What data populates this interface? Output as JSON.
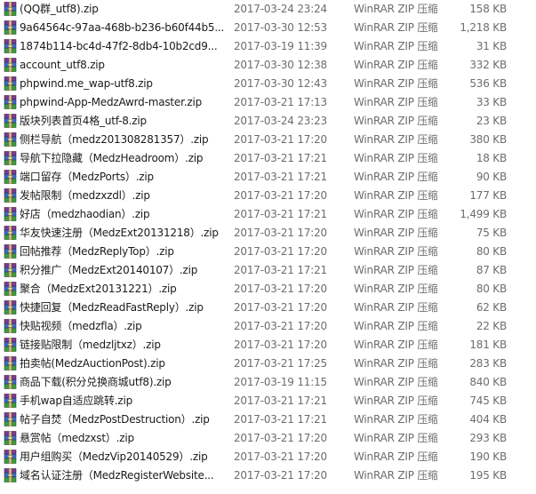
{
  "icons": {
    "row_icon": "winrar-archive-icon"
  },
  "colors": {
    "name_text": "#1a1a1a",
    "meta_text": "#6d6d6d",
    "background": "#ffffff"
  },
  "files": [
    {
      "name": "(QQ群_utf8).zip",
      "date": "2017-03-24 23:24",
      "type": "WinRAR ZIP 压缩...",
      "size": "158 KB"
    },
    {
      "name": "9a64564c-97aa-468b-b236-b60f44b5...",
      "date": "2017-03-30 12:53",
      "type": "WinRAR ZIP 压缩...",
      "size": "1,218 KB"
    },
    {
      "name": "1874b114-bc4d-47f2-8db4-10b2cd9...",
      "date": "2017-03-19 11:39",
      "type": "WinRAR ZIP 压缩...",
      "size": "31 KB"
    },
    {
      "name": "account_utf8.zip",
      "date": "2017-03-30 12:38",
      "type": "WinRAR ZIP 压缩...",
      "size": "332 KB"
    },
    {
      "name": "phpwind.me_wap-utf8.zip",
      "date": "2017-03-30 12:43",
      "type": "WinRAR ZIP 压缩...",
      "size": "536 KB"
    },
    {
      "name": "phpwind-App-MedzAwrd-master.zip",
      "date": "2017-03-21 17:13",
      "type": "WinRAR ZIP 压缩...",
      "size": "33 KB"
    },
    {
      "name": "版块列表首页4格_utf-8.zip",
      "date": "2017-03-24 23:23",
      "type": "WinRAR ZIP 压缩...",
      "size": "23 KB"
    },
    {
      "name": "侧栏导航（medz201308281357）.zip",
      "date": "2017-03-21 17:20",
      "type": "WinRAR ZIP 压缩...",
      "size": "380 KB"
    },
    {
      "name": "导航下拉隐藏（MedzHeadroom）.zip",
      "date": "2017-03-21 17:21",
      "type": "WinRAR ZIP 压缩...",
      "size": "18 KB"
    },
    {
      "name": "端口留存（MedzPorts）.zip",
      "date": "2017-03-21 17:21",
      "type": "WinRAR ZIP 压缩...",
      "size": "90 KB"
    },
    {
      "name": "发帖限制（medzxzdl）.zip",
      "date": "2017-03-21 17:20",
      "type": "WinRAR ZIP 压缩...",
      "size": "177 KB"
    },
    {
      "name": "好店（medzhaodian）.zip",
      "date": "2017-03-21 17:21",
      "type": "WinRAR ZIP 压缩...",
      "size": "1,499 KB"
    },
    {
      "name": "华友快速注册（MedzExt20131218）.zip",
      "date": "2017-03-21 17:20",
      "type": "WinRAR ZIP 压缩...",
      "size": "75 KB"
    },
    {
      "name": "回帖推荐（MedzReplyTop）.zip",
      "date": "2017-03-21 17:20",
      "type": "WinRAR ZIP 压缩...",
      "size": "80 KB"
    },
    {
      "name": "积分推广（MedzExt20140107）.zip",
      "date": "2017-03-21 17:21",
      "type": "WinRAR ZIP 压缩...",
      "size": "87 KB"
    },
    {
      "name": "聚合（MedzExt20131221）.zip",
      "date": "2017-03-21 17:20",
      "type": "WinRAR ZIP 压缩...",
      "size": "80 KB"
    },
    {
      "name": "快捷回复（MedzReadFastReply）.zip",
      "date": "2017-03-21 17:20",
      "type": "WinRAR ZIP 压缩...",
      "size": "62 KB"
    },
    {
      "name": "快贴视频（medzfla）.zip",
      "date": "2017-03-21 17:20",
      "type": "WinRAR ZIP 压缩...",
      "size": "22 KB"
    },
    {
      "name": "链接贴限制（medzljtxz）.zip",
      "date": "2017-03-21 17:20",
      "type": "WinRAR ZIP 压缩...",
      "size": "181 KB"
    },
    {
      "name": "拍卖帖(MedzAuctionPost).zip",
      "date": "2017-03-21 17:25",
      "type": "WinRAR ZIP 压缩...",
      "size": "283 KB"
    },
    {
      "name": "商品下载(积分兑换商城utf8).zip",
      "date": "2017-03-19 11:15",
      "type": "WinRAR ZIP 压缩...",
      "size": "840 KB"
    },
    {
      "name": "手机wap自适应跳转.zip",
      "date": "2017-03-21 17:21",
      "type": "WinRAR ZIP 压缩...",
      "size": "745 KB"
    },
    {
      "name": "帖子自焚（MedzPostDestruction）.zip",
      "date": "2017-03-21 17:21",
      "type": "WinRAR ZIP 压缩...",
      "size": "404 KB"
    },
    {
      "name": "悬赏帖（medzxst）.zip",
      "date": "2017-03-21 17:20",
      "type": "WinRAR ZIP 压缩...",
      "size": "293 KB"
    },
    {
      "name": "用户组购买（MedzVip20140529）.zip",
      "date": "2017-03-21 17:20",
      "type": "WinRAR ZIP 压缩...",
      "size": "190 KB"
    },
    {
      "name": "域名认证注册（MedzRegisterWebsite...",
      "date": "2017-03-21 17:20",
      "type": "WinRAR ZIP 压缩...",
      "size": "195 KB"
    }
  ]
}
